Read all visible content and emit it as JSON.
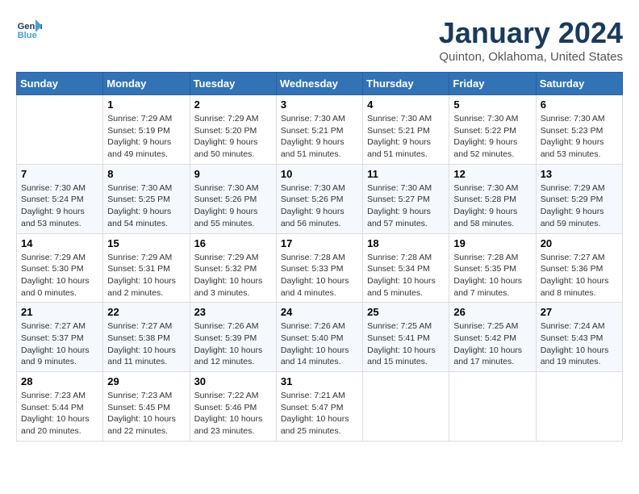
{
  "header": {
    "logo_text_general": "General",
    "logo_text_blue": "Blue",
    "month": "January 2024",
    "location": "Quinton, Oklahoma, United States"
  },
  "weekdays": [
    "Sunday",
    "Monday",
    "Tuesday",
    "Wednesday",
    "Thursday",
    "Friday",
    "Saturday"
  ],
  "weeks": [
    [
      {
        "day": "",
        "detail": ""
      },
      {
        "day": "1",
        "detail": "Sunrise: 7:29 AM\nSunset: 5:19 PM\nDaylight: 9 hours\nand 49 minutes."
      },
      {
        "day": "2",
        "detail": "Sunrise: 7:29 AM\nSunset: 5:20 PM\nDaylight: 9 hours\nand 50 minutes."
      },
      {
        "day": "3",
        "detail": "Sunrise: 7:30 AM\nSunset: 5:21 PM\nDaylight: 9 hours\nand 51 minutes."
      },
      {
        "day": "4",
        "detail": "Sunrise: 7:30 AM\nSunset: 5:21 PM\nDaylight: 9 hours\nand 51 minutes."
      },
      {
        "day": "5",
        "detail": "Sunrise: 7:30 AM\nSunset: 5:22 PM\nDaylight: 9 hours\nand 52 minutes."
      },
      {
        "day": "6",
        "detail": "Sunrise: 7:30 AM\nSunset: 5:23 PM\nDaylight: 9 hours\nand 53 minutes."
      }
    ],
    [
      {
        "day": "7",
        "detail": "Sunrise: 7:30 AM\nSunset: 5:24 PM\nDaylight: 9 hours\nand 53 minutes."
      },
      {
        "day": "8",
        "detail": "Sunrise: 7:30 AM\nSunset: 5:25 PM\nDaylight: 9 hours\nand 54 minutes."
      },
      {
        "day": "9",
        "detail": "Sunrise: 7:30 AM\nSunset: 5:26 PM\nDaylight: 9 hours\nand 55 minutes."
      },
      {
        "day": "10",
        "detail": "Sunrise: 7:30 AM\nSunset: 5:26 PM\nDaylight: 9 hours\nand 56 minutes."
      },
      {
        "day": "11",
        "detail": "Sunrise: 7:30 AM\nSunset: 5:27 PM\nDaylight: 9 hours\nand 57 minutes."
      },
      {
        "day": "12",
        "detail": "Sunrise: 7:30 AM\nSunset: 5:28 PM\nDaylight: 9 hours\nand 58 minutes."
      },
      {
        "day": "13",
        "detail": "Sunrise: 7:29 AM\nSunset: 5:29 PM\nDaylight: 9 hours\nand 59 minutes."
      }
    ],
    [
      {
        "day": "14",
        "detail": "Sunrise: 7:29 AM\nSunset: 5:30 PM\nDaylight: 10 hours\nand 0 minutes."
      },
      {
        "day": "15",
        "detail": "Sunrise: 7:29 AM\nSunset: 5:31 PM\nDaylight: 10 hours\nand 2 minutes."
      },
      {
        "day": "16",
        "detail": "Sunrise: 7:29 AM\nSunset: 5:32 PM\nDaylight: 10 hours\nand 3 minutes."
      },
      {
        "day": "17",
        "detail": "Sunrise: 7:28 AM\nSunset: 5:33 PM\nDaylight: 10 hours\nand 4 minutes."
      },
      {
        "day": "18",
        "detail": "Sunrise: 7:28 AM\nSunset: 5:34 PM\nDaylight: 10 hours\nand 5 minutes."
      },
      {
        "day": "19",
        "detail": "Sunrise: 7:28 AM\nSunset: 5:35 PM\nDaylight: 10 hours\nand 7 minutes."
      },
      {
        "day": "20",
        "detail": "Sunrise: 7:27 AM\nSunset: 5:36 PM\nDaylight: 10 hours\nand 8 minutes."
      }
    ],
    [
      {
        "day": "21",
        "detail": "Sunrise: 7:27 AM\nSunset: 5:37 PM\nDaylight: 10 hours\nand 9 minutes."
      },
      {
        "day": "22",
        "detail": "Sunrise: 7:27 AM\nSunset: 5:38 PM\nDaylight: 10 hours\nand 11 minutes."
      },
      {
        "day": "23",
        "detail": "Sunrise: 7:26 AM\nSunset: 5:39 PM\nDaylight: 10 hours\nand 12 minutes."
      },
      {
        "day": "24",
        "detail": "Sunrise: 7:26 AM\nSunset: 5:40 PM\nDaylight: 10 hours\nand 14 minutes."
      },
      {
        "day": "25",
        "detail": "Sunrise: 7:25 AM\nSunset: 5:41 PM\nDaylight: 10 hours\nand 15 minutes."
      },
      {
        "day": "26",
        "detail": "Sunrise: 7:25 AM\nSunset: 5:42 PM\nDaylight: 10 hours\nand 17 minutes."
      },
      {
        "day": "27",
        "detail": "Sunrise: 7:24 AM\nSunset: 5:43 PM\nDaylight: 10 hours\nand 19 minutes."
      }
    ],
    [
      {
        "day": "28",
        "detail": "Sunrise: 7:23 AM\nSunset: 5:44 PM\nDaylight: 10 hours\nand 20 minutes."
      },
      {
        "day": "29",
        "detail": "Sunrise: 7:23 AM\nSunset: 5:45 PM\nDaylight: 10 hours\nand 22 minutes."
      },
      {
        "day": "30",
        "detail": "Sunrise: 7:22 AM\nSunset: 5:46 PM\nDaylight: 10 hours\nand 23 minutes."
      },
      {
        "day": "31",
        "detail": "Sunrise: 7:21 AM\nSunset: 5:47 PM\nDaylight: 10 hours\nand 25 minutes."
      },
      {
        "day": "",
        "detail": ""
      },
      {
        "day": "",
        "detail": ""
      },
      {
        "day": "",
        "detail": ""
      }
    ]
  ]
}
